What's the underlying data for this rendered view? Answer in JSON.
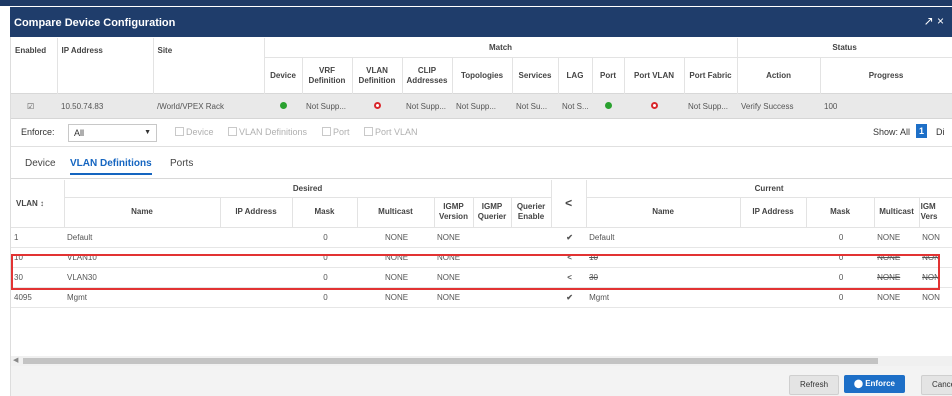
{
  "window": {
    "title": "Compare Device Configuration",
    "expand_glyph": "↗ ×"
  },
  "device_table": {
    "group_match": "Match",
    "group_status": "Status",
    "headers": [
      "Enabled",
      "IP Address",
      "Site",
      "Device",
      "VRF Definition",
      "VLAN Definition",
      "CLIP Addresses",
      "Topologies",
      "Services",
      "LAG",
      "Port",
      "Port VLAN",
      "Port Fabric",
      "Action",
      "Progress"
    ],
    "row": {
      "enabled": "☑",
      "ip": "10.50.74.83",
      "site": "/World/VPEX Rack",
      "vrf": "Not Supp...",
      "clip": "Not Supp...",
      "topologies": "Not Supp...",
      "services": "Not Su...",
      "lag": "Not S...",
      "port_fabric": "Not Supp...",
      "action": "Verify Success",
      "progress": "100"
    }
  },
  "filter": {
    "enforce_label": "Enforce:",
    "enforce_value": "All",
    "checks": [
      "Device",
      "VLAN Definitions",
      "Port",
      "Port VLAN"
    ],
    "show_label": "Show: All",
    "show_count": "1",
    "show_rest": "Di"
  },
  "tabs": [
    "Device",
    "VLAN Definitions",
    "Ports"
  ],
  "vlan_grid": {
    "desired_label": "Desired",
    "current_label": "Current",
    "headers": {
      "vlan": "VLAN ↕",
      "name": "Name",
      "ip": "IP Address",
      "mask": "Mask",
      "multicast": "Multicast",
      "igmp_version": "IGMP Version",
      "igmp_querier": "IGMP Querier",
      "querier_enable": "Querier Enable",
      "arrow": "<",
      "cur_name": "Name",
      "cur_ip": "IP Address",
      "cur_mask": "Mask",
      "cur_multicast": "Multicast",
      "cur_igmp": "IGM Vers"
    },
    "rows": [
      {
        "vlan": "1",
        "name": "Default",
        "mask": "0",
        "multicast": "NONE",
        "igmp": "NONE",
        "status": "✔",
        "cur_name": "Default",
        "cur_mask": "0",
        "cur_multicast": "NONE",
        "cur_igmp": "NON"
      },
      {
        "vlan": "10",
        "name": "VLAN10",
        "mask": "0",
        "multicast": "NONE",
        "igmp": "NONE",
        "status": "<",
        "cur_name": "10",
        "cur_mask": "0",
        "cur_multicast": "NONE",
        "cur_igmp": "NON"
      },
      {
        "vlan": "30",
        "name": "VLAN30",
        "mask": "0",
        "multicast": "NONE",
        "igmp": "NONE",
        "status": "<",
        "cur_name": "30",
        "cur_mask": "0",
        "cur_multicast": "NONE",
        "cur_igmp": "NON"
      },
      {
        "vlan": "4095",
        "name": "Mgmt",
        "mask": "0",
        "multicast": "NONE",
        "igmp": "NONE",
        "status": "✔",
        "cur_name": "Mgmt",
        "cur_mask": "0",
        "cur_multicast": "NONE",
        "cur_igmp": "NON"
      }
    ]
  },
  "footer": {
    "refresh": "Refresh",
    "enforce": "Enforce",
    "cancel": "Cancel"
  },
  "colors": {
    "titlebar": "#1f3d6b",
    "accent": "#1565c0",
    "ok": "#2aa12f",
    "error": "#d8262b",
    "highlight": "#e23333"
  }
}
